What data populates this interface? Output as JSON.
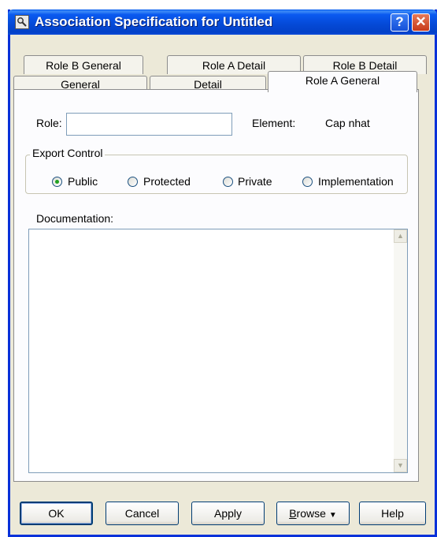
{
  "window": {
    "title": "Association Specification for Untitled",
    "help_glyph": "?",
    "close_glyph": "✕"
  },
  "tabs": {
    "back_row": [
      "Role B General",
      "Role A Detail",
      "Role B Detail"
    ],
    "front_row": [
      "General",
      "Detail",
      "Role A General"
    ],
    "active": "Role A General"
  },
  "form": {
    "role_label": "Role:",
    "role_value": "",
    "element_label": "Element:",
    "element_value": "Cap nhat",
    "export_control": {
      "legend": "Export Control",
      "options": [
        "Public",
        "Protected",
        "Private",
        "Implementation"
      ],
      "selected": "Public"
    },
    "documentation_label": "Documentation:",
    "documentation_value": ""
  },
  "buttons": {
    "ok": "OK",
    "cancel": "Cancel",
    "apply": "Apply",
    "browse_underlined": "B",
    "browse_rest": "rowse",
    "help": "Help"
  },
  "colors": {
    "titlebar": "#0449d6",
    "dialog_bg": "#ece9d8",
    "panel_bg": "#fcfcfe",
    "radio_dot": "#21a121"
  },
  "icons": {
    "title_icon": "magnifier-icon",
    "help": "question-icon",
    "close": "close-icon",
    "browse_arrow": "triangle-down-icon",
    "scroll_up": "chevron-up-icon",
    "scroll_down": "chevron-down-icon"
  }
}
